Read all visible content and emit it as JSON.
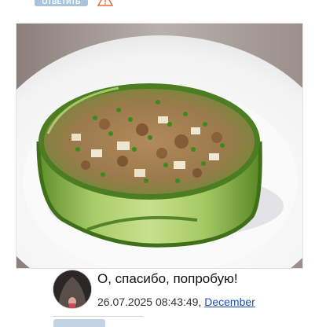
{
  "comment": {
    "reply_button_label": "ответить",
    "text": "О, спасибо, попробую!",
    "timestamp": "26.07.2025 08:43:49,",
    "author": "December"
  },
  "icons": {
    "warning": "warning-triangle-icon",
    "avatar": "user-avatar"
  },
  "colors": {
    "link": "#1a4fb0",
    "reply_button": "#a9c3d8",
    "warning": "#e06a3a"
  }
}
